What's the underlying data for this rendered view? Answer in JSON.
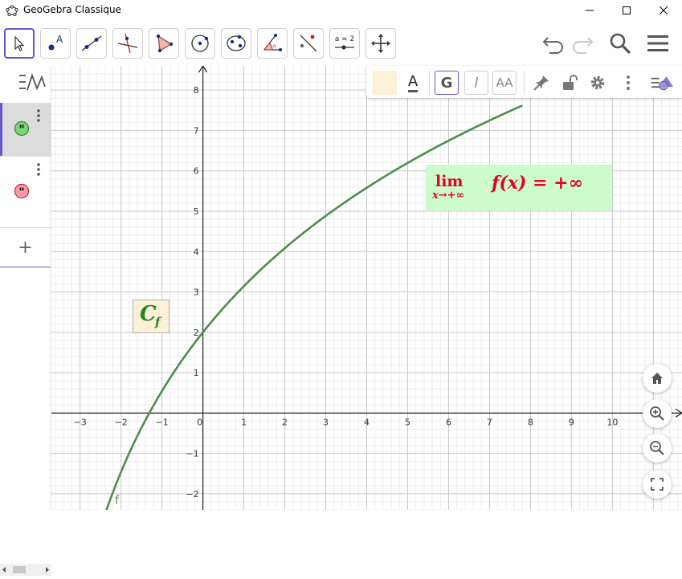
{
  "window": {
    "title": "GeoGebra Classique"
  },
  "toolbar": {
    "equation_tool_label": "a = 2"
  },
  "style_bar": {
    "text_label": "A",
    "bold_label": "G",
    "italic_label": "I",
    "size_label": "AA"
  },
  "algebra": {
    "plus_label": "+"
  },
  "graph": {
    "x_range": [
      -3.7,
      11.7
    ],
    "y_range": [
      -2.4,
      8.6
    ],
    "x_ticks": [
      "−3",
      "−2",
      "−1",
      "0",
      "1",
      "2",
      "3",
      "4",
      "5",
      "6",
      "7",
      "8",
      "9",
      "10"
    ],
    "y_ticks": [
      "−2",
      "−1",
      "1",
      "2",
      "3",
      "4",
      "5",
      "6",
      "7",
      "8"
    ],
    "curve_label": "f",
    "curve_color": "#4a8f4a"
  },
  "latex": {
    "lim": "lim",
    "sub": "x→+∞",
    "expr": "f(x) = +∞",
    "text_color": "#e0002a",
    "bg_color": "#ccfbcc"
  },
  "caption": {
    "letter": "C",
    "subscript": "f",
    "color": "#1f8a1f"
  },
  "colors": {
    "accent": "#6557d2"
  }
}
